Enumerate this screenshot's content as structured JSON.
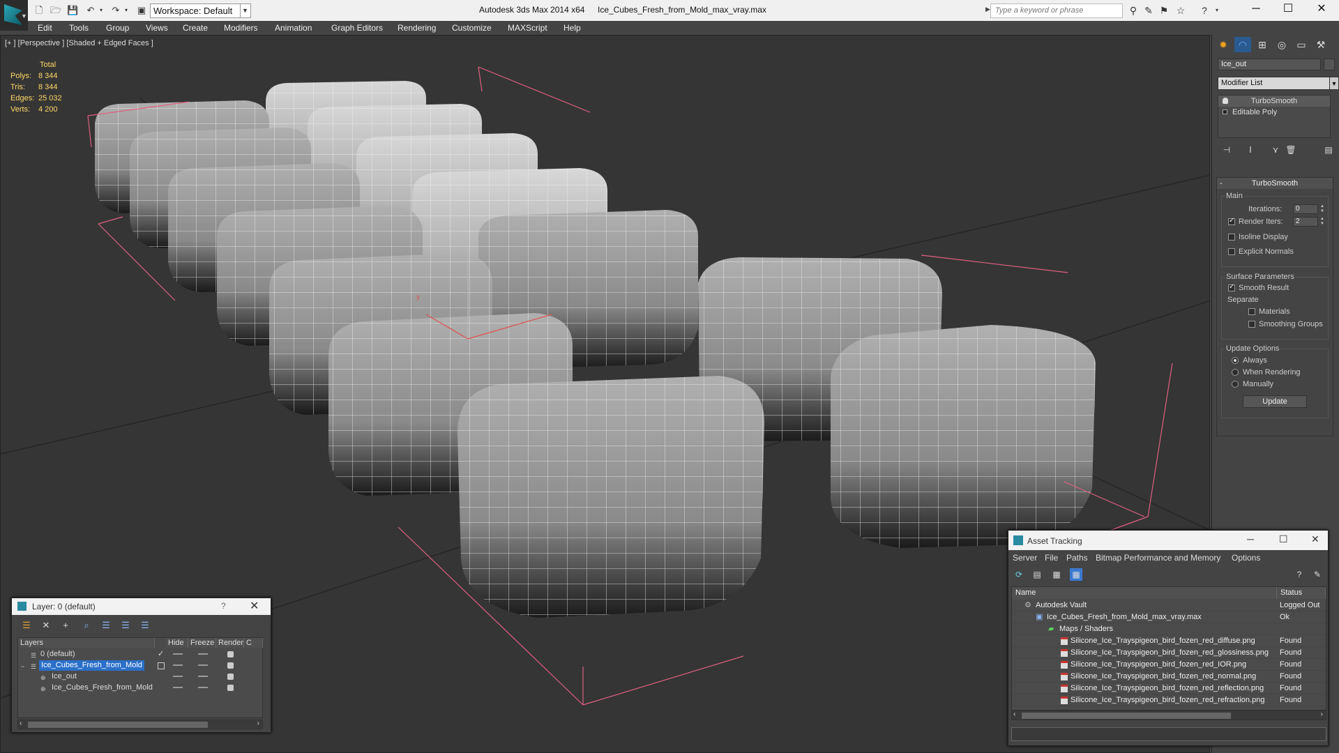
{
  "titlebar": {
    "workspace": "Workspace: Default",
    "app_title": "Autodesk 3ds Max  2014 x64",
    "file_title": "Ice_Cubes_Fresh_from_Mold_max_vray.max",
    "search_placeholder": "Type a keyword or phrase"
  },
  "menubar": [
    "Edit",
    "Tools",
    "Group",
    "Views",
    "Create",
    "Modifiers",
    "Animation",
    "Graph Editors",
    "Rendering",
    "Customize",
    "MAXScript",
    "Help"
  ],
  "viewport": {
    "label": "[+ ] [Perspective ] [Shaded + Edged Faces ]",
    "stats": {
      "header": "Total",
      "rows": [
        {
          "key": "Polys:",
          "value": "8 344"
        },
        {
          "key": "Tris:",
          "value": "8 344"
        },
        {
          "key": "Edges:",
          "value": "25 032"
        },
        {
          "key": "Verts:",
          "value": "4 200"
        }
      ]
    }
  },
  "command_panel": {
    "object_name": "Ice_out",
    "modifier_list": "Modifier List",
    "stack": [
      "TurboSmooth",
      "Editable Poly"
    ],
    "rollout_title": "TurboSmooth",
    "main_label": "Main",
    "iterations_label": "Iterations:",
    "iterations_value": "0",
    "render_iters_label": "Render Iters:",
    "render_iters_value": "2",
    "isoline": "Isoline Display",
    "explicit_normals": "Explicit Normals",
    "surface_params": "Surface Parameters",
    "smooth_result": "Smooth Result",
    "separate": "Separate",
    "materials": "Materials",
    "smoothing_groups": "Smoothing Groups",
    "update_options": "Update Options",
    "always": "Always",
    "when_rendering": "When Rendering",
    "manually": "Manually",
    "update_button": "Update"
  },
  "layer_window": {
    "title": "Layer: 0 (default)",
    "help": "?",
    "columns": [
      "Layers",
      "Hide",
      "Freeze",
      "Render",
      "C"
    ],
    "rows": [
      {
        "name": "0 (default)"
      },
      {
        "name": "Ice_Cubes_Fresh_from_Mold"
      },
      {
        "name": "Ice_out"
      },
      {
        "name": "Ice_Cubes_Fresh_from_Mold"
      }
    ]
  },
  "asset_window": {
    "title": "Asset Tracking",
    "menu": [
      "Server",
      "File",
      "Paths",
      "Bitmap Performance and Memory",
      "Options"
    ],
    "columns": [
      "Name",
      "Status"
    ],
    "rows": [
      {
        "name": "Autodesk Vault",
        "status": "Logged Out"
      },
      {
        "name": "Ice_Cubes_Fresh_from_Mold_max_vray.max",
        "status": "Ok"
      },
      {
        "name": "Maps / Shaders",
        "status": ""
      },
      {
        "name": "Silicone_Ice_Trayspigeon_bird_fozen_red_diffuse.png",
        "status": "Found"
      },
      {
        "name": "Silicone_Ice_Trayspigeon_bird_fozen_red_glossiness.png",
        "status": "Found"
      },
      {
        "name": "Silicone_Ice_Trayspigeon_bird_fozen_red_IOR.png",
        "status": "Found"
      },
      {
        "name": "Silicone_Ice_Trayspigeon_bird_fozen_red_normal.png",
        "status": "Found"
      },
      {
        "name": "Silicone_Ice_Trayspigeon_bird_fozen_red_reflection.png",
        "status": "Found"
      },
      {
        "name": "Silicone_Ice_Trayspigeon_bird_fozen_red_refraction.png",
        "status": "Found"
      }
    ]
  }
}
